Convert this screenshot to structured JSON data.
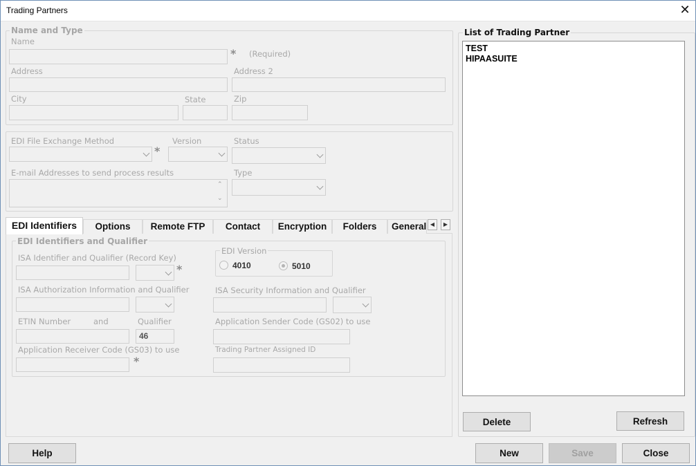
{
  "window": {
    "title": "Trading Partners",
    "close_glyph": "✕"
  },
  "name_type": {
    "legend": "Name and Type",
    "name_label": "Name",
    "name_value": "",
    "required_marker": "*",
    "required_text": "(Required)",
    "address_label": "Address",
    "address_value": "",
    "address2_label": "Address 2",
    "address2_value": "",
    "city_label": "City",
    "city_value": "",
    "state_label": "State",
    "state_value": "",
    "zip_label": "Zip",
    "zip_value": ""
  },
  "exchange": {
    "method_label": "EDI File Exchange Method",
    "method_value": "",
    "required_marker": "*",
    "version_label": "Version",
    "version_value": "",
    "status_label": "Status",
    "status_value": "",
    "email_label": "E-mail Addresses to send process results",
    "email_value": "",
    "type_label": "Type",
    "type_value": "",
    "scroll_up": "⌃",
    "scroll_down": "⌄"
  },
  "tabs": [
    {
      "label": "EDI Identifiers",
      "active": true
    },
    {
      "label": "Options"
    },
    {
      "label": "Remote FTP"
    },
    {
      "label": "Contact"
    },
    {
      "label": "Encryption"
    },
    {
      "label": "Folders"
    },
    {
      "label": "General"
    }
  ],
  "tab_scroll": {
    "left": "◀",
    "right": "▶"
  },
  "edi_identifiers": {
    "legend": "EDI Identifiers and Qualifier",
    "isa_id_label": "ISA Identifier and Qualifier (Record Key)",
    "isa_id_value": "",
    "isa_id_qualifier": "",
    "required_marker": "*",
    "edi_version_legend": "EDI Version",
    "version_options": [
      "4010",
      "5010"
    ],
    "version_selected": "5010",
    "isa_auth_label": "ISA Authorization Information and Qualifier",
    "isa_auth_value": "",
    "isa_auth_qualifier": "",
    "isa_security_label": "ISA Security Information and Qualifier",
    "isa_security_value": "",
    "isa_security_qualifier": "",
    "etin_label": "ETIN  Number",
    "etin_and": "and",
    "etin_value": "",
    "qualifier_label": "Qualifier",
    "qualifier_value": "46",
    "sender_label": "Application Sender Code (GS02) to use",
    "sender_value": "",
    "receiver_label": "Application Receiver Code (GS03) to use",
    "receiver_value": "",
    "tp_assigned_label": "Trading Partner Assigned ID",
    "tp_assigned_value": ""
  },
  "partner_list": {
    "legend": "List of Trading Partner",
    "items": [
      "TEST",
      "HIPAASUITE"
    ],
    "delete_label": "Delete",
    "refresh_label": "Refresh"
  },
  "footer": {
    "help_label": "Help",
    "new_label": "New",
    "save_label": "Save",
    "close_label": "Close"
  }
}
